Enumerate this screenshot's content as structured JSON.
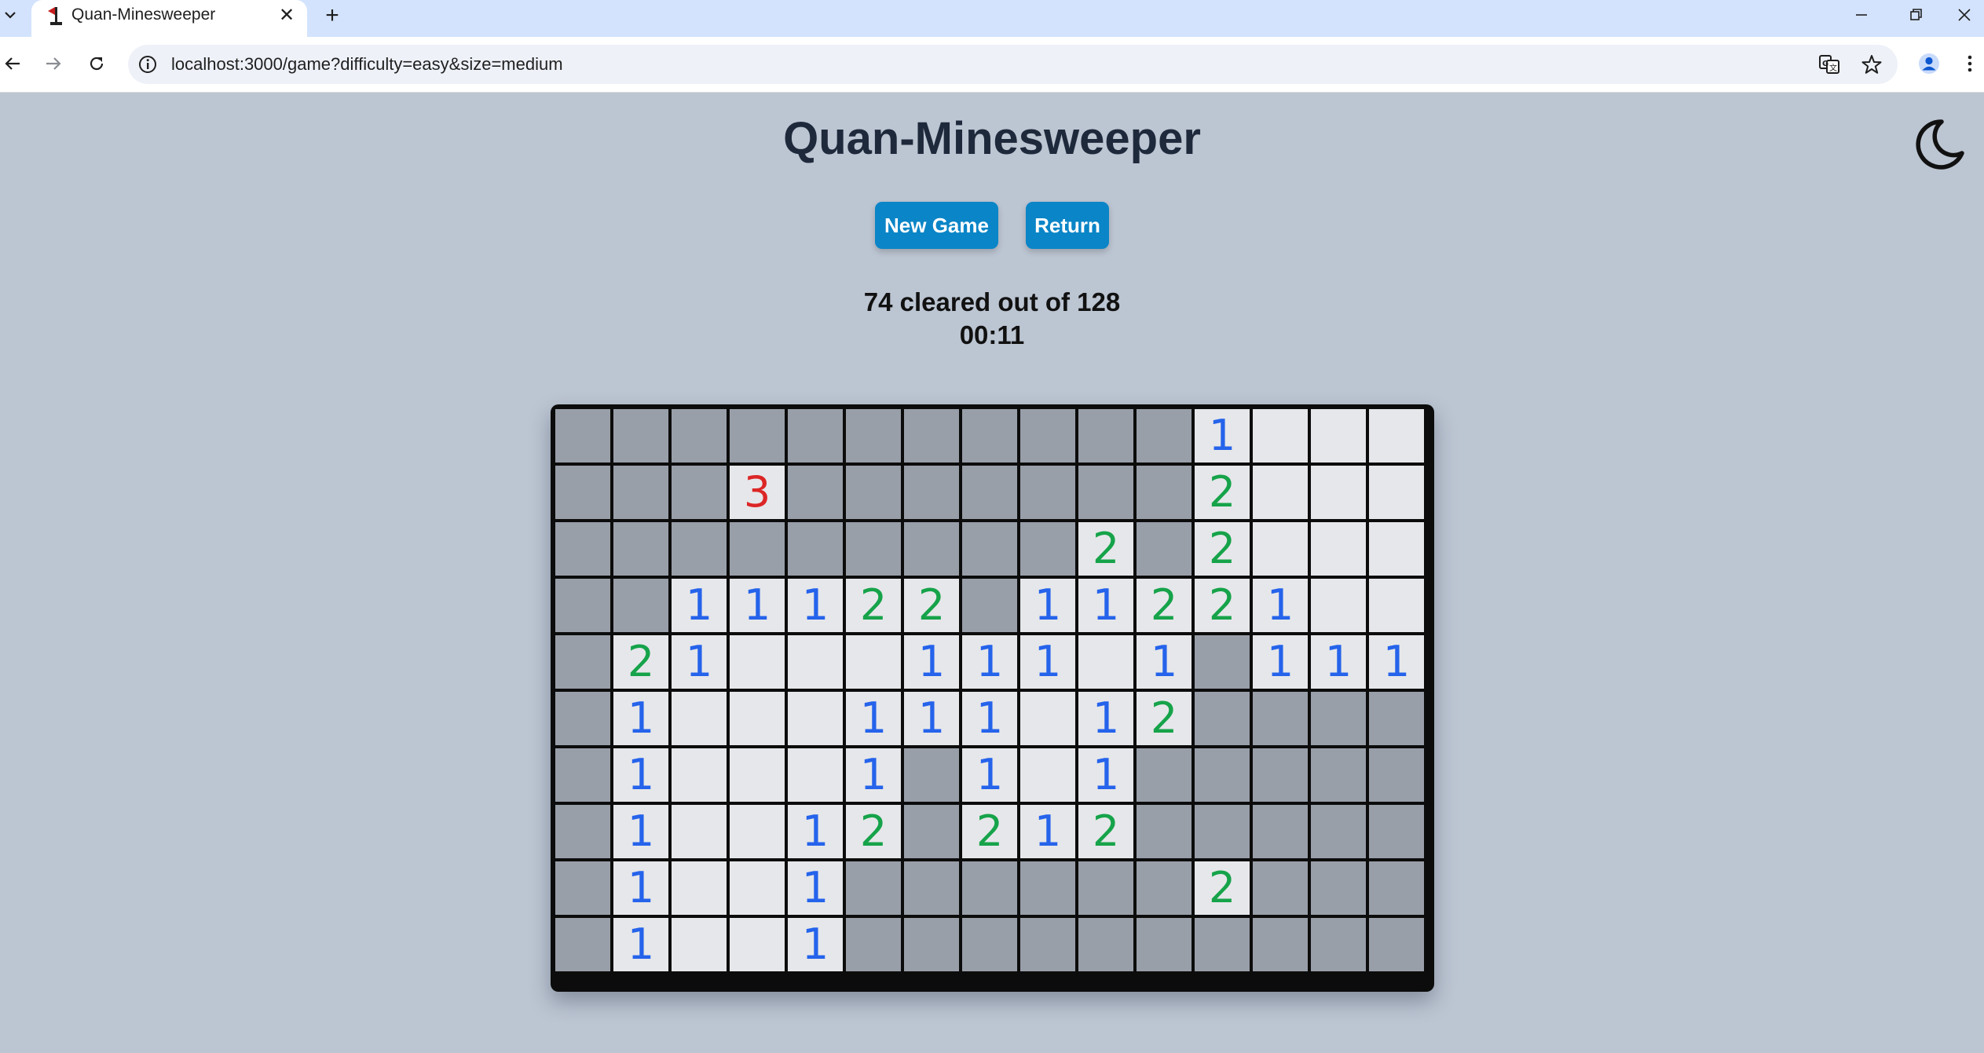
{
  "browser": {
    "tab_title": "Quan-Minesweeper",
    "new_tab_symbol": "+",
    "close_symbol": "✕",
    "url": "localhost:3000/game?difficulty=easy&size=medium"
  },
  "page": {
    "title": "Quan-Minesweeper",
    "new_game_label": "New Game",
    "return_label": "Return",
    "progress_text": "74 cleared out of 128",
    "timer": "00:11",
    "theme_icon": "moon-icon"
  },
  "board": {
    "columns": 15,
    "rows_count": 10,
    "legend": "# = covered, . = open empty, digit = open cell showing that number",
    "rows": [
      "###########1...",
      "###3#######2...",
      "#########2#2...",
      "##11122#11221..",
      "#21...111.1#111",
      "#1...111.12####",
      "#1...1#1.1#####",
      "#1..12#212#####",
      "#1..1######2###",
      "#1..1##########"
    ]
  },
  "colors": {
    "background": "#bcc5d2",
    "button": "#0a85c7",
    "covered_cell": "#999fa9",
    "open_cell": "#e6e7ea",
    "number_1": "#2563eb",
    "number_2": "#16a34a",
    "number_3": "#dc2626"
  }
}
